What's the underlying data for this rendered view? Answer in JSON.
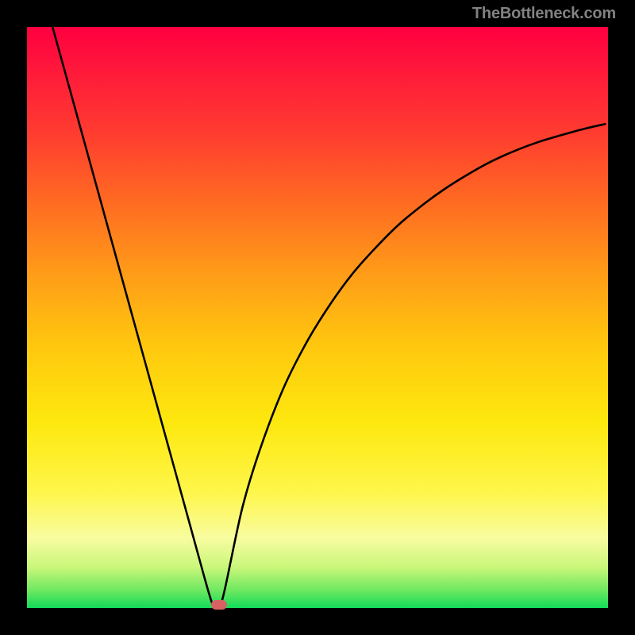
{
  "attribution": "TheBottleneck.com",
  "colors": {
    "gradient_top": "#ff0040",
    "gradient_mid": "#ffc80e",
    "gradient_bottom": "#11db5a",
    "curve": "#000000",
    "marker": "#d86262",
    "page_bg": "#000000"
  },
  "chart_data": {
    "type": "line",
    "title": "",
    "xlabel": "",
    "ylabel": "",
    "xlim": [
      0,
      100
    ],
    "ylim": [
      0,
      100
    ],
    "series": [
      {
        "name": "bottleneck-curve",
        "x": [
          4.4,
          8,
          12,
          16,
          20,
          24,
          28,
          30.5,
          32,
          33,
          34,
          37,
          40,
          44,
          48,
          52,
          56,
          60,
          64,
          68,
          72,
          76,
          80,
          84,
          88,
          92,
          96,
          99.5
        ],
        "y": [
          100,
          87,
          72.5,
          58,
          43.5,
          29,
          14.5,
          5.4,
          0.5,
          0,
          3,
          17,
          27,
          37.5,
          45.5,
          52,
          57.5,
          62,
          66,
          69.3,
          72.2,
          74.7,
          76.9,
          78.7,
          80.2,
          81.4,
          82.5,
          83.3
        ]
      }
    ],
    "marker": {
      "x": 33,
      "y": 0.5,
      "color": "#d86262"
    },
    "grid": false,
    "legend": false
  }
}
